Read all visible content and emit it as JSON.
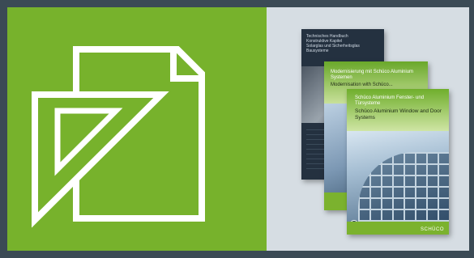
{
  "brochures": {
    "back": {
      "title": "Technisches Handbuch\nKonstruktive Kapitel\nSolarglas und Sicherheitsglas\nBausysteme"
    },
    "middle": {
      "title_de": "Modernisierung mit Schüco Aluminium Systemen",
      "title_en": "Modernisation with Schüco..."
    },
    "front": {
      "title_de": "Schüco Aluminium Fenster- und Türsysteme",
      "title_en": "Schüco Aluminium Window and Door Systems",
      "brand": "SCHÜCO"
    }
  },
  "colors": {
    "green_tile": "#77b22c",
    "gray_tile": "#d6dde3",
    "frame": "#3b4a55",
    "icon_stroke": "#ffffff"
  },
  "icons": {
    "drawing": "technical-drawing-icon"
  }
}
